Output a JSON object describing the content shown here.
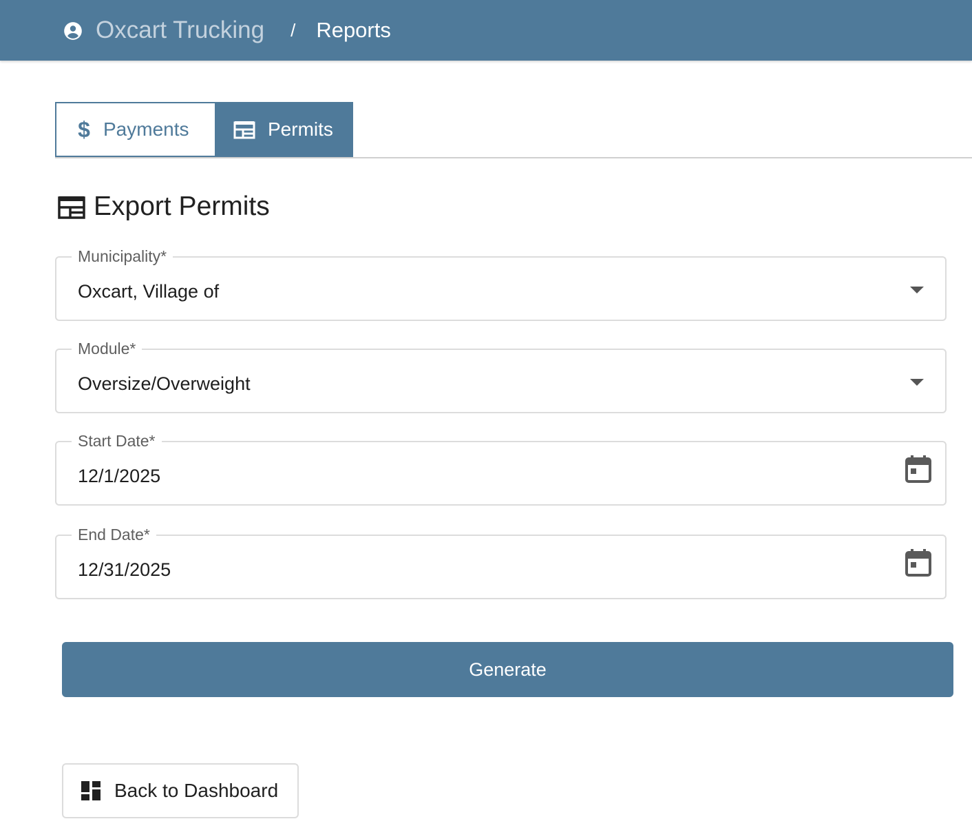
{
  "header": {
    "org_name": "Oxcart Trucking",
    "separator": "/",
    "page_name": "Reports",
    "bar_color": "#4f7a9a"
  },
  "tabs": [
    {
      "label": "Payments",
      "icon": "dollar-icon",
      "active": false
    },
    {
      "label": "Permits",
      "icon": "table-icon",
      "active": true
    }
  ],
  "section": {
    "title": "Export Permits",
    "icon": "table-icon"
  },
  "form": {
    "municipality": {
      "label": "Municipality*",
      "value": "Oxcart, Village of",
      "icon": "chevron-down-icon"
    },
    "module": {
      "label": "Module*",
      "value": "Oversize/Overweight",
      "icon": "chevron-down-icon"
    },
    "start_date": {
      "label": "Start Date*",
      "value": "12/1/2025",
      "icon": "calendar-icon"
    },
    "end_date": {
      "label": "End Date*",
      "value": "12/31/2025",
      "icon": "calendar-icon"
    }
  },
  "actions": {
    "generate_label": "Generate",
    "back_label": "Back to Dashboard",
    "back_icon": "dashboard-icon"
  }
}
